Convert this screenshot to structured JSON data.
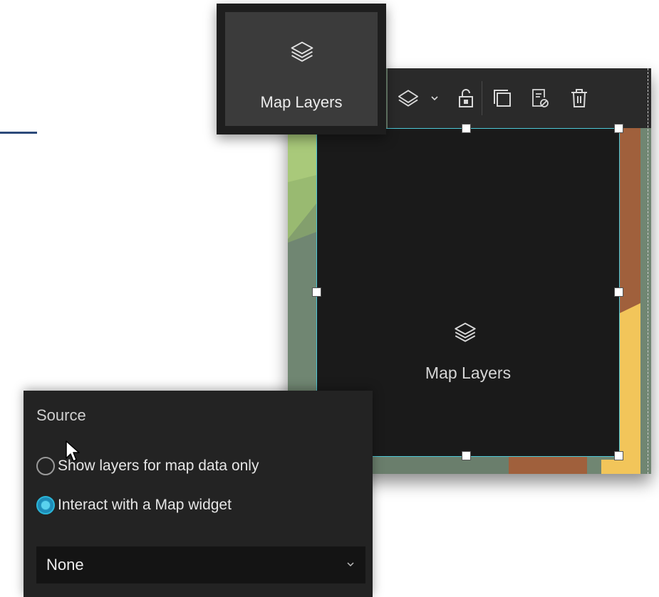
{
  "tooltip": {
    "label": "Map Layers",
    "icon": "layers-icon"
  },
  "toolbar": {
    "items": [
      "layers-icon",
      "chevron-down-icon",
      "unlock-icon",
      "duplicate-icon",
      "hide-icon",
      "trash-icon"
    ]
  },
  "widget": {
    "label": "Map Layers",
    "icon": "layers-icon"
  },
  "colors": {
    "accent": "#4ec9d8",
    "radio_selected": "#2bb6d8",
    "panel_bg": "#232323"
  },
  "source_panel": {
    "title": "Source",
    "options": [
      {
        "label": "Show layers for map data only",
        "selected": false
      },
      {
        "label": "Interact with a Map widget",
        "selected": true
      }
    ],
    "select": {
      "value": "None",
      "icon": "chevron-down-icon"
    }
  }
}
